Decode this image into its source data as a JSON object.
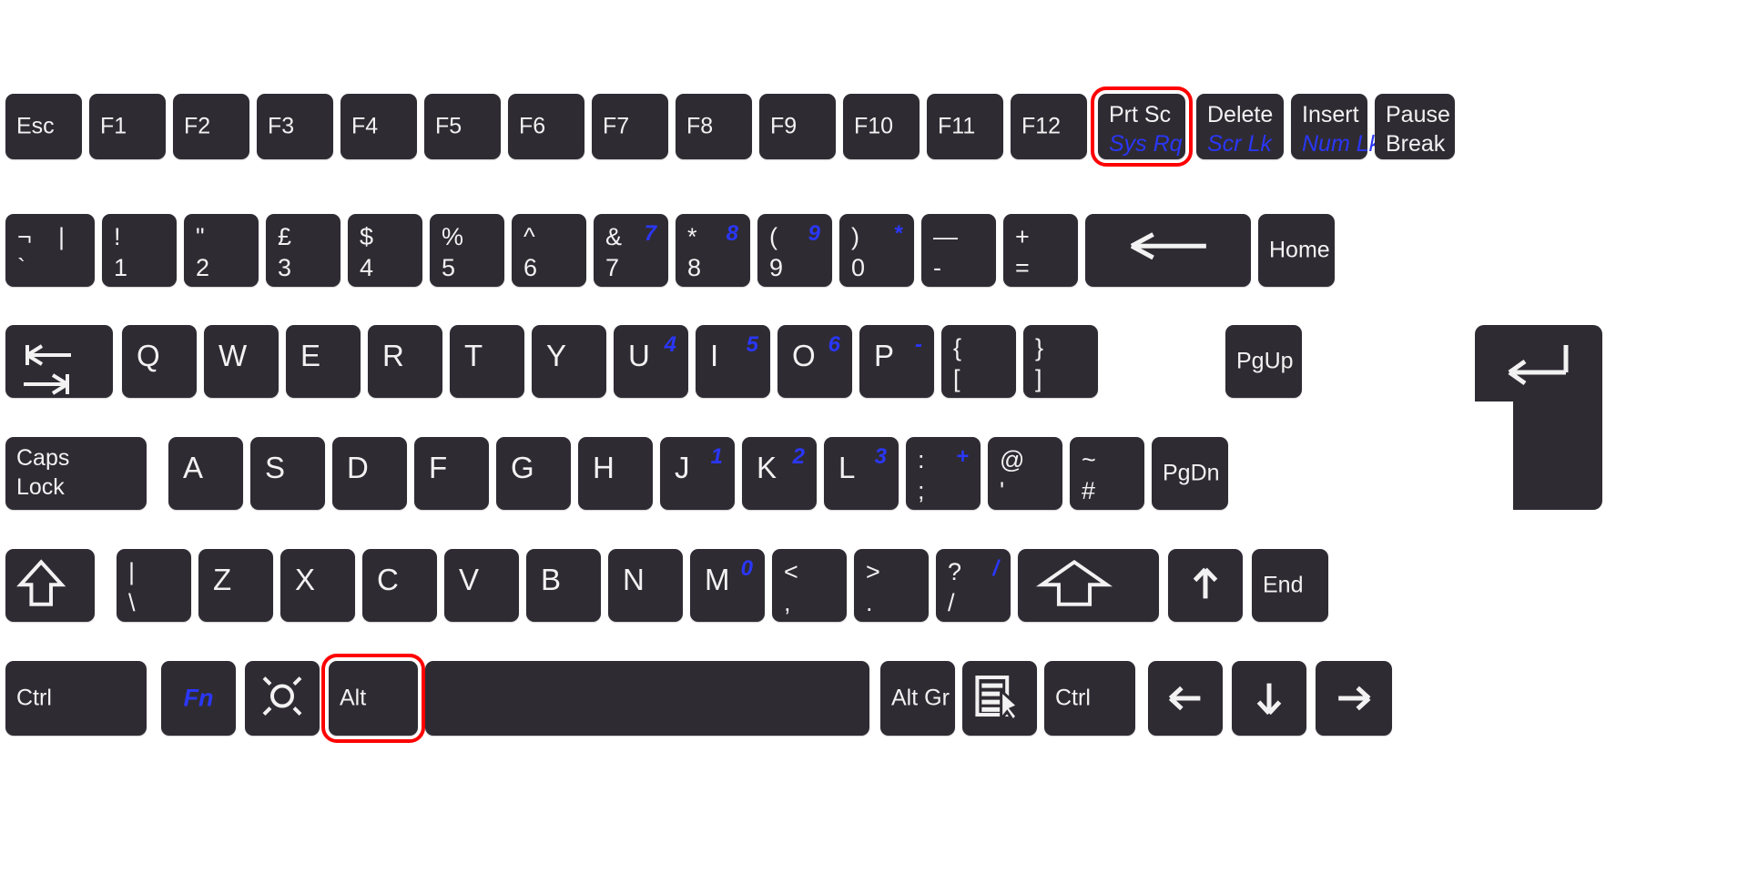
{
  "meta": {
    "device": "laptop-keyboard",
    "layout": "UK",
    "bg_color": "#ffffff",
    "key_color": "#2f2b33",
    "legend_color": "#f2f2f2",
    "accent_blue": "#2a37f7",
    "highlight_color": "#ff0000"
  },
  "highlighted_keys": [
    "Prt Sc / Sys Rq",
    "Alt"
  ],
  "rows": {
    "function_row": [
      {
        "id": "esc",
        "main": "Esc"
      },
      {
        "id": "f1",
        "main": "F1"
      },
      {
        "id": "f2",
        "main": "F2"
      },
      {
        "id": "f3",
        "main": "F3"
      },
      {
        "id": "f4",
        "main": "F4"
      },
      {
        "id": "f5",
        "main": "F5"
      },
      {
        "id": "f6",
        "main": "F6"
      },
      {
        "id": "f7",
        "main": "F7"
      },
      {
        "id": "f8",
        "main": "F8"
      },
      {
        "id": "f9",
        "main": "F9"
      },
      {
        "id": "f10",
        "main": "F10"
      },
      {
        "id": "f11",
        "main": "F11"
      },
      {
        "id": "f12",
        "main": "F12"
      },
      {
        "id": "prtsc",
        "main": "Prt Sc",
        "sub": "Sys Rq",
        "sub_blue": true,
        "highlighted": true
      },
      {
        "id": "delete",
        "main": "Delete",
        "sub": "Scr Lk",
        "sub_blue": true
      },
      {
        "id": "insert",
        "main": "Insert",
        "sub": "Num Lk",
        "sub_blue": true
      },
      {
        "id": "pause",
        "main": "Pause",
        "sub": "Break"
      }
    ],
    "number_row": [
      {
        "id": "backtick",
        "upper": "¬",
        "lower": "`",
        "upper2": "|"
      },
      {
        "id": "1",
        "upper": "!",
        "lower": "1"
      },
      {
        "id": "2",
        "upper": "\"",
        "lower": "2"
      },
      {
        "id": "3",
        "upper": "£",
        "lower": "3"
      },
      {
        "id": "4",
        "upper": "$",
        "lower": "4"
      },
      {
        "id": "5",
        "upper": "%",
        "lower": "5"
      },
      {
        "id": "6",
        "upper": "^",
        "lower": "6"
      },
      {
        "id": "7",
        "upper": "&",
        "lower": "7",
        "numpad": "7"
      },
      {
        "id": "8",
        "upper": "*",
        "lower": "8",
        "numpad": "8"
      },
      {
        "id": "9",
        "upper": "(",
        "lower": "9",
        "numpad": "9"
      },
      {
        "id": "0",
        "upper": ")",
        "lower": "0",
        "numpad": "*"
      },
      {
        "id": "minus",
        "upper": "—",
        "lower": "-"
      },
      {
        "id": "equals",
        "upper": "+",
        "lower": "="
      },
      {
        "id": "backspace",
        "icon": "backspace-arrow-icon"
      },
      {
        "id": "home",
        "main": "Home"
      }
    ],
    "qwerty_row": [
      {
        "id": "tab",
        "icon": "tab-icon"
      },
      {
        "id": "q",
        "alpha": "Q"
      },
      {
        "id": "w",
        "alpha": "W"
      },
      {
        "id": "e",
        "alpha": "E"
      },
      {
        "id": "r",
        "alpha": "R"
      },
      {
        "id": "t",
        "alpha": "T"
      },
      {
        "id": "y",
        "alpha": "Y"
      },
      {
        "id": "u",
        "alpha": "U",
        "numpad": "4"
      },
      {
        "id": "i",
        "alpha": "I",
        "numpad": "5"
      },
      {
        "id": "o",
        "alpha": "O",
        "numpad": "6"
      },
      {
        "id": "p",
        "alpha": "P",
        "numpad": "-"
      },
      {
        "id": "lbracket",
        "upper": "{",
        "lower": "["
      },
      {
        "id": "rbracket",
        "upper": "}",
        "lower": "]"
      },
      {
        "id": "enter",
        "icon": "enter-icon"
      },
      {
        "id": "pgup",
        "main": "PgUp"
      }
    ],
    "home_row": [
      {
        "id": "capslock",
        "main": "Caps",
        "sub": "Lock"
      },
      {
        "id": "a",
        "alpha": "A"
      },
      {
        "id": "s",
        "alpha": "S"
      },
      {
        "id": "d",
        "alpha": "D"
      },
      {
        "id": "f",
        "alpha": "F"
      },
      {
        "id": "g",
        "alpha": "G"
      },
      {
        "id": "h",
        "alpha": "H"
      },
      {
        "id": "j",
        "alpha": "J",
        "numpad": "1"
      },
      {
        "id": "k",
        "alpha": "K",
        "numpad": "2"
      },
      {
        "id": "l",
        "alpha": "L",
        "numpad": "3"
      },
      {
        "id": "semicolon",
        "upper": ":",
        "lower": ";",
        "numpad": "+"
      },
      {
        "id": "apostrophe",
        "upper": "@",
        "lower": "'"
      },
      {
        "id": "hash",
        "upper": "~",
        "lower": "#"
      },
      {
        "id": "pgdn",
        "main": "PgDn"
      }
    ],
    "shift_row": [
      {
        "id": "lshift",
        "icon": "shift-icon"
      },
      {
        "id": "backslash",
        "upper": "|",
        "lower": "\\"
      },
      {
        "id": "z",
        "alpha": "Z"
      },
      {
        "id": "x",
        "alpha": "X"
      },
      {
        "id": "c",
        "alpha": "C"
      },
      {
        "id": "v",
        "alpha": "V"
      },
      {
        "id": "b",
        "alpha": "B"
      },
      {
        "id": "n",
        "alpha": "N"
      },
      {
        "id": "m",
        "alpha": "M",
        "numpad": "0"
      },
      {
        "id": "comma",
        "upper": "<",
        "lower": ","
      },
      {
        "id": "period",
        "upper": ">",
        "lower": "."
      },
      {
        "id": "slash",
        "upper": "?",
        "lower": "/",
        "numpad": "/"
      },
      {
        "id": "rshift",
        "icon": "shift-icon"
      },
      {
        "id": "arrowup",
        "icon": "arrow-up-icon"
      },
      {
        "id": "end",
        "main": "End"
      }
    ],
    "bottom_row": [
      {
        "id": "lctrl",
        "main": "Ctrl"
      },
      {
        "id": "fn",
        "main": "Fn",
        "blue": true
      },
      {
        "id": "super",
        "icon": "super-icon"
      },
      {
        "id": "lalt",
        "main": "Alt",
        "highlighted": true
      },
      {
        "id": "space",
        "main": ""
      },
      {
        "id": "altgr",
        "main": "Alt Gr"
      },
      {
        "id": "menu",
        "icon": "context-menu-icon"
      },
      {
        "id": "rctrl",
        "main": "Ctrl"
      },
      {
        "id": "arrowleft",
        "icon": "arrow-left-icon"
      },
      {
        "id": "arrowdown",
        "icon": "arrow-down-icon"
      },
      {
        "id": "arrowright",
        "icon": "arrow-right-icon"
      }
    ]
  }
}
